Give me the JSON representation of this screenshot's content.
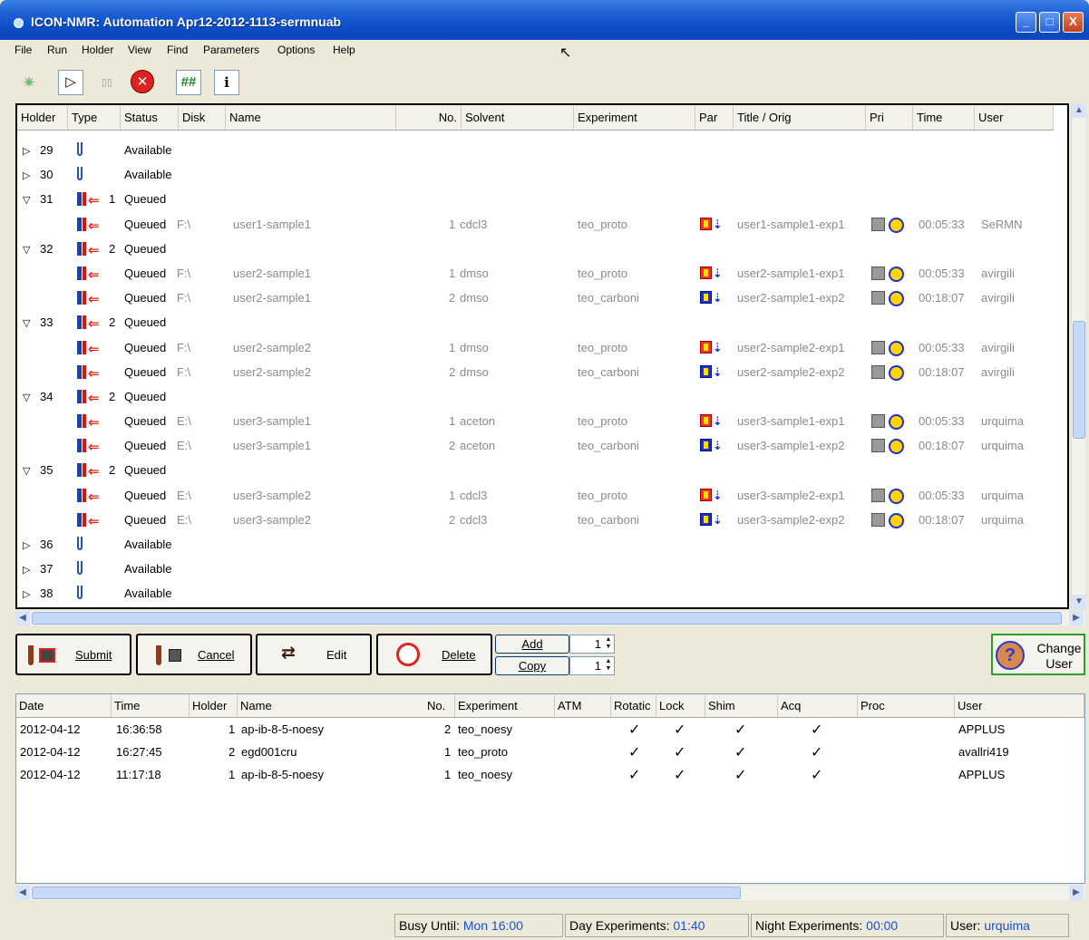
{
  "window": {
    "title": "ICON-NMR: Automation Apr12-2012-1113-sermnuab",
    "min_label": "_",
    "max_label": "□",
    "close_label": "X"
  },
  "menu": [
    "File",
    "Run",
    "Holder",
    "View",
    "Find",
    "Parameters",
    "Options",
    "Help"
  ],
  "toolbar": {
    "icons": [
      "gear-icon",
      "play-icon",
      "pause-icon",
      "stop-icon",
      "grid-icon",
      "info-icon"
    ],
    "play_glyph": "▷",
    "pause_glyph": "▯▯",
    "stop_glyph": "✕",
    "grid_glyph": "##",
    "info_glyph": "i",
    "gear_glyph": "✷"
  },
  "queue": {
    "columns": [
      "Holder",
      "Type",
      "Status",
      "Disk",
      "Name",
      "No.",
      "Solvent",
      "Experiment",
      "Par",
      "Title / Orig",
      "Pri",
      "Time",
      "User"
    ],
    "rows": [
      {
        "kind": "holder",
        "expand": "▷",
        "holder": "29",
        "count": "",
        "status": "Available"
      },
      {
        "kind": "holder",
        "expand": "▷",
        "holder": "30",
        "count": "",
        "status": "Available"
      },
      {
        "kind": "group",
        "expand": "▽",
        "holder": "31",
        "count": "1",
        "status": "Queued"
      },
      {
        "kind": "exp",
        "status": "Queued",
        "disk": "F:\\",
        "name": "user1-sample1",
        "no": "1",
        "solvent": "cdcl3",
        "experiment": "teo_proto",
        "par": "red",
        "title": "user1-sample1-exp1",
        "time": "00:05:33",
        "user": "SeRMN"
      },
      {
        "kind": "group",
        "expand": "▽",
        "holder": "32",
        "count": "2",
        "status": "Queued"
      },
      {
        "kind": "exp",
        "status": "Queued",
        "disk": "F:\\",
        "name": "user2-sample1",
        "no": "1",
        "solvent": "dmso",
        "experiment": "teo_proto",
        "par": "red",
        "title": "user2-sample1-exp1",
        "time": "00:05:33",
        "user": "avirgili"
      },
      {
        "kind": "exp",
        "status": "Queued",
        "disk": "F:\\",
        "name": "user2-sample1",
        "no": "2",
        "solvent": "dmso",
        "experiment": "teo_carboni",
        "par": "blue",
        "title": "user2-sample1-exp2",
        "time": "00:18:07",
        "user": "avirgili"
      },
      {
        "kind": "group",
        "expand": "▽",
        "holder": "33",
        "count": "2",
        "status": "Queued"
      },
      {
        "kind": "exp",
        "status": "Queued",
        "disk": "F:\\",
        "name": "user2-sample2",
        "no": "1",
        "solvent": "dmso",
        "experiment": "teo_proto",
        "par": "red",
        "title": "user2-sample2-exp1",
        "time": "00:05:33",
        "user": "avirgili"
      },
      {
        "kind": "exp",
        "status": "Queued",
        "disk": "F:\\",
        "name": "user2-sample2",
        "no": "2",
        "solvent": "dmso",
        "experiment": "teo_carboni",
        "par": "blue",
        "title": "user2-sample2-exp2",
        "time": "00:18:07",
        "user": "avirgili"
      },
      {
        "kind": "group",
        "expand": "▽",
        "holder": "34",
        "count": "2",
        "status": "Queued"
      },
      {
        "kind": "exp",
        "status": "Queued",
        "disk": "E:\\",
        "name": "user3-sample1",
        "no": "1",
        "solvent": "aceton",
        "experiment": "teo_proto",
        "par": "red",
        "title": "user3-sample1-exp1",
        "time": "00:05:33",
        "user": "urquima"
      },
      {
        "kind": "exp",
        "status": "Queued",
        "disk": "E:\\",
        "name": "user3-sample1",
        "no": "2",
        "solvent": "aceton",
        "experiment": "teo_carboni",
        "par": "blue",
        "title": "user3-sample1-exp2",
        "time": "00:18:07",
        "user": "urquima"
      },
      {
        "kind": "group",
        "expand": "▽",
        "holder": "35",
        "count": "2",
        "status": "Queued"
      },
      {
        "kind": "exp",
        "status": "Queued",
        "disk": "E:\\",
        "name": "user3-sample2",
        "no": "1",
        "solvent": "cdcl3",
        "experiment": "teo_proto",
        "par": "red",
        "title": "user3-sample2-exp1",
        "time": "00:05:33",
        "user": "urquima"
      },
      {
        "kind": "exp",
        "status": "Queued",
        "disk": "E:\\",
        "name": "user3-sample2",
        "no": "2",
        "solvent": "cdcl3",
        "experiment": "teo_carboni",
        "par": "blue",
        "title": "user3-sample2-exp2",
        "time": "00:18:07",
        "user": "urquima"
      },
      {
        "kind": "holder",
        "expand": "▷",
        "holder": "36",
        "count": "",
        "status": "Available"
      },
      {
        "kind": "holder",
        "expand": "▷",
        "holder": "37",
        "count": "",
        "status": "Available"
      },
      {
        "kind": "holder",
        "expand": "▷",
        "holder": "38",
        "count": "",
        "status": "Available"
      }
    ]
  },
  "actions": {
    "submit": "Submit",
    "cancel": "Cancel",
    "edit": "Edit",
    "delete": "Delete",
    "add": "Add",
    "copy": "Copy",
    "add_count": "1",
    "copy_count": "1",
    "change_user": "Change User"
  },
  "history": {
    "columns": [
      "Date",
      "Time",
      "Holder",
      "Name",
      "No.",
      "Experiment",
      "ATM",
      "Rotatic",
      "Lock",
      "Shim",
      "Acq",
      "Proc",
      "User"
    ],
    "check_glyph": "✓",
    "rows": [
      {
        "date": "2012-04-12",
        "time": "16:36:58",
        "holder": "1",
        "name": "ap-ib-8-5-noesy",
        "no": "2",
        "experiment": "teo_noesy",
        "user": "APPLUS"
      },
      {
        "date": "2012-04-12",
        "time": "16:27:45",
        "holder": "2",
        "name": "egd001cru",
        "no": "1",
        "experiment": "teo_proto",
        "user": "avallri419"
      },
      {
        "date": "2012-04-12",
        "time": "11:17:18",
        "holder": "1",
        "name": "ap-ib-8-5-noesy",
        "no": "1",
        "experiment": "teo_noesy",
        "user": "APPLUS"
      }
    ]
  },
  "status": {
    "busy_label": "Busy Until:",
    "busy_value": "Mon 16:00",
    "day_label": "Day Experiments:",
    "day_value": "01:40",
    "night_label": "Night Experiments:",
    "night_value": "00:00",
    "user_label": "User:",
    "user_value": "urquima"
  }
}
